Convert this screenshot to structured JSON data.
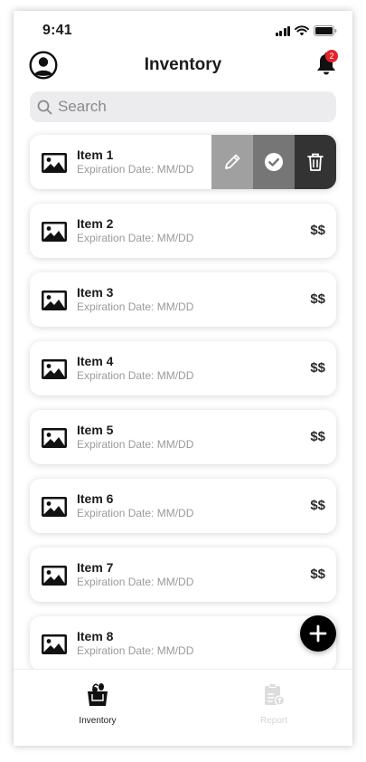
{
  "status_bar": {
    "time": "9:41"
  },
  "header": {
    "title": "Inventory",
    "notification_count": "2"
  },
  "search": {
    "placeholder": "Search"
  },
  "items": [
    {
      "name": "Item 1",
      "expiration": "Expiration Date: MM/DD",
      "price": "$$",
      "swiped": true
    },
    {
      "name": "Item 2",
      "expiration": "Expiration Date: MM/DD",
      "price": "$$"
    },
    {
      "name": "Item 3",
      "expiration": "Expiration Date: MM/DD",
      "price": "$$"
    },
    {
      "name": "Item 4",
      "expiration": "Expiration Date: MM/DD",
      "price": "$$"
    },
    {
      "name": "Item 5",
      "expiration": "Expiration Date: MM/DD",
      "price": "$$"
    },
    {
      "name": "Item 6",
      "expiration": "Expiration Date: MM/DD",
      "price": "$$"
    },
    {
      "name": "Item 7",
      "expiration": "Expiration Date: MM/DD",
      "price": "$$"
    },
    {
      "name": "Item 8",
      "expiration": "Expiration Date: MM/DD",
      "price": "$$"
    }
  ],
  "swipe_actions": [
    "pencil-icon",
    "check-circle-icon",
    "trash-icon"
  ],
  "tabs": [
    {
      "label": "Inventory",
      "icon": "grocery-bag-icon",
      "active": true
    },
    {
      "label": "Report",
      "icon": "report-icon",
      "active": false
    }
  ],
  "colors": {
    "accent": "#000000",
    "badge": "#e5222b",
    "swipe_edit": "#a0a0a0",
    "swipe_done": "#767676",
    "swipe_delete": "#333333",
    "inactive_tab": "#d4d4d6"
  }
}
